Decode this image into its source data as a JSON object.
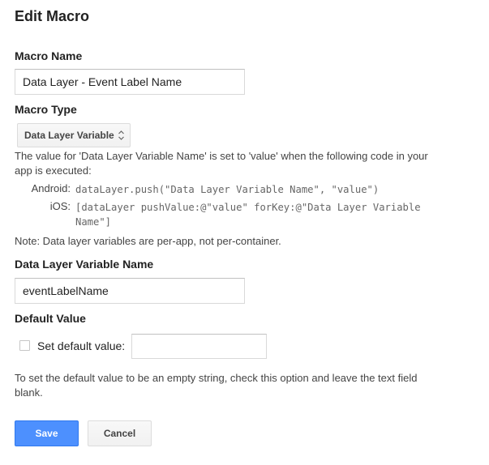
{
  "title": "Edit Macro",
  "macro_name": {
    "label": "Macro Name",
    "value": "Data Layer - Event Label Name"
  },
  "macro_type": {
    "label": "Macro Type",
    "selected": "Data Layer Variable",
    "description_line1": "The value for 'Data Layer Variable Name' is set to 'value' when the following code in your",
    "description_line2": "app is executed:",
    "android_label": "Android:",
    "android_code": "dataLayer.push(\"Data Layer Variable Name\", \"value\")",
    "ios_label": "iOS:",
    "ios_code_line1": "[dataLayer pushValue:@\"value\" forKey:@\"Data Layer Variable",
    "ios_code_line2": "Name\"]",
    "note": "Note: Data layer variables are per-app, not per-container."
  },
  "variable_name": {
    "label": "Data Layer Variable Name",
    "value": "eventLabelName"
  },
  "default_value": {
    "label": "Default Value",
    "checkbox_label": "Set default value:",
    "checked": false,
    "input_value": "",
    "help_line1": "To set the default value to be an empty string, check this option and leave the text field",
    "help_line2": "blank."
  },
  "buttons": {
    "save": "Save",
    "cancel": "Cancel"
  },
  "colors": {
    "primary_button": "#4d90fe",
    "text": "#222222",
    "muted_text": "#444444"
  }
}
